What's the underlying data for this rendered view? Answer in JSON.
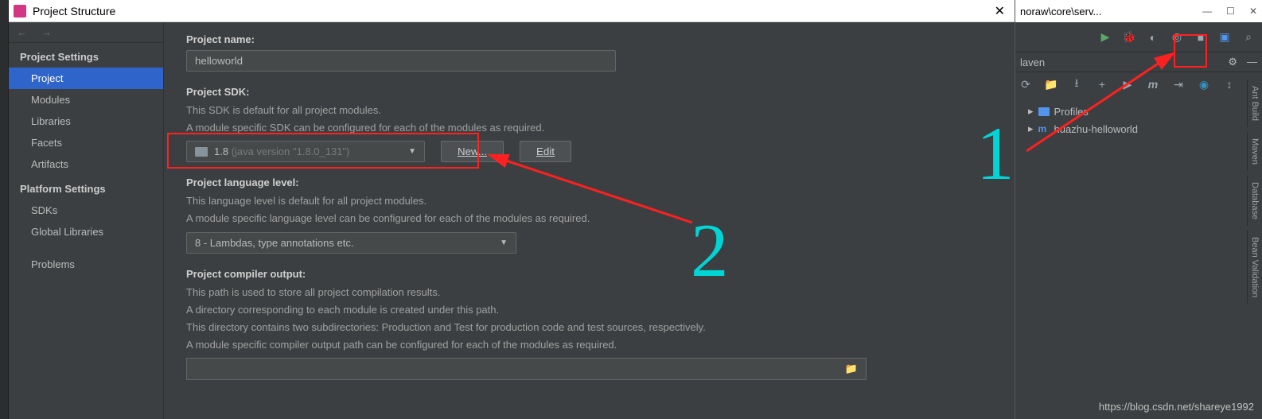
{
  "dialog": {
    "title": "Project Structure",
    "close_glyph": "✕",
    "nav": {
      "back": "←",
      "fwd": "→"
    },
    "sidebar": {
      "sec1": "Project Settings",
      "items1": [
        "Project",
        "Modules",
        "Libraries",
        "Facets",
        "Artifacts"
      ],
      "sec2": "Platform Settings",
      "items2": [
        "SDKs",
        "Global Libraries"
      ],
      "items3": [
        "Problems"
      ]
    },
    "content": {
      "project_name_label": "Project name:",
      "project_name_value": "helloworld",
      "sdk_label": "Project SDK:",
      "sdk_desc1": "This SDK is default for all project modules.",
      "sdk_desc2": "A module specific SDK can be configured for each of the modules as required.",
      "sdk_value": "1.8",
      "sdk_hint": " (java version \"1.8.0_131\")",
      "new_label": "New...",
      "edit_label": "Edit",
      "lang_label": "Project language level:",
      "lang_desc1": "This language level is default for all project modules.",
      "lang_desc2": "A module specific language level can be configured for each of the modules as required.",
      "lang_value": "8 - Lambdas, type annotations etc.",
      "out_label": "Project compiler output:",
      "out_desc1": "This path is used to store all project compilation results.",
      "out_desc2": "A directory corresponding to each module is created under this path.",
      "out_desc3": "This directory contains two subdirectories: Production and Test for production code and test sources, respectively.",
      "out_desc4": "A module specific compiler output path can be configured for each of the modules as required."
    }
  },
  "bg_window": {
    "title_fragment": "noraw\\core\\serv...",
    "maven_title": "laven",
    "profiles": "Profiles",
    "project_item": "huazhu-helloworld",
    "side_tabs": [
      "Ant Build",
      "Maven",
      "Database",
      "Bean Validation"
    ]
  },
  "annotations": {
    "num1": "1",
    "num2": "2"
  },
  "watermark": "https://blog.csdn.net/shareye1992"
}
